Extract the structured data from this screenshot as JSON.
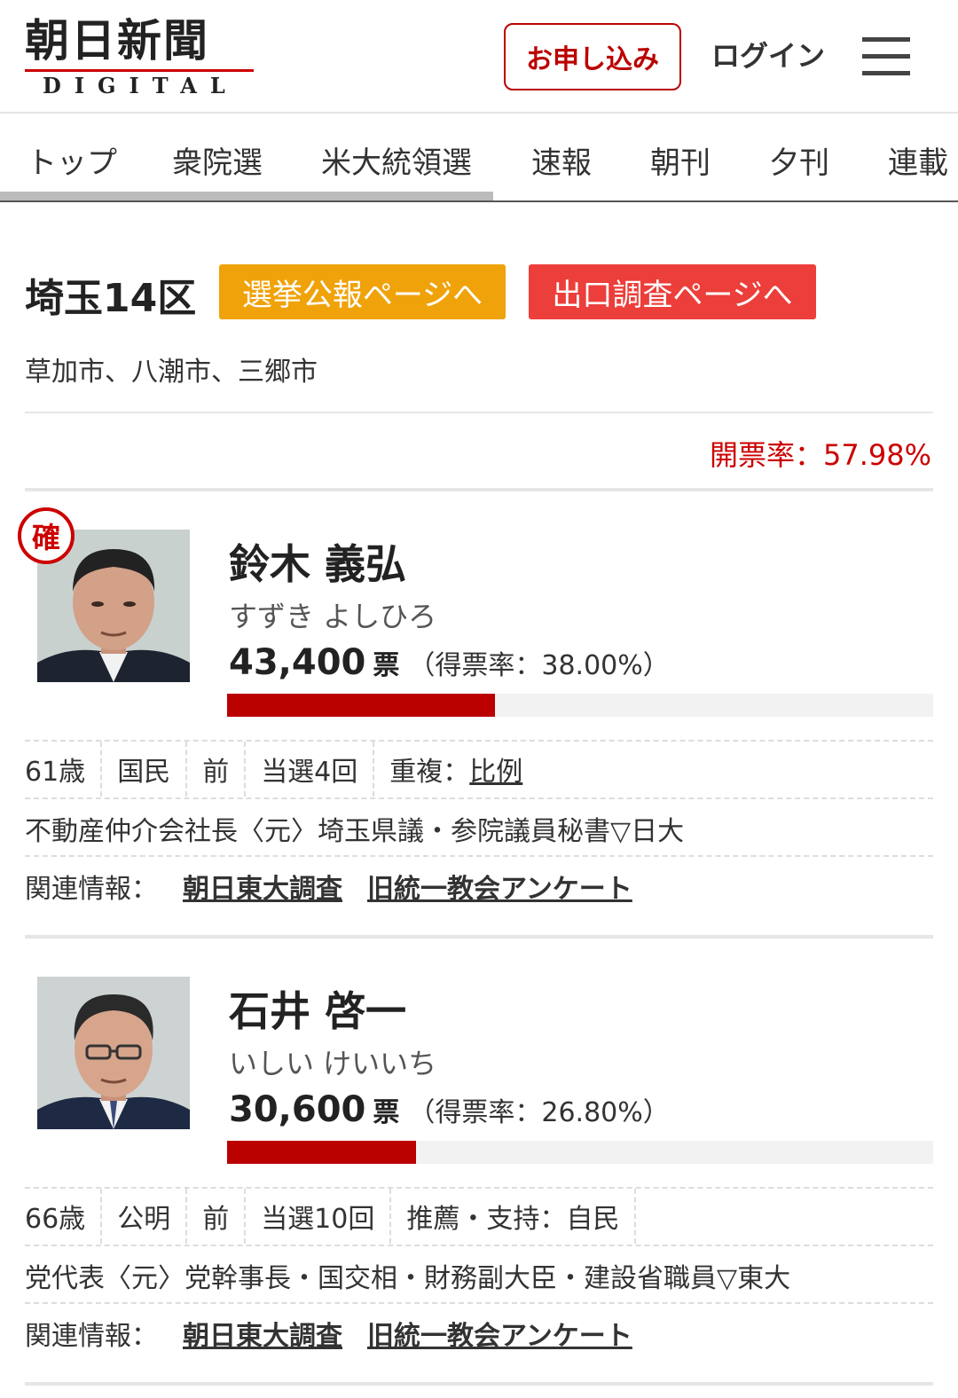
{
  "header": {
    "logo_jp": "朝日新聞",
    "logo_en": "DIGITAL",
    "apply_label": "お申し込み",
    "login_label": "ログイン"
  },
  "nav": {
    "items": [
      "トップ",
      "衆院選",
      "米大統領選",
      "速報",
      "朝刊",
      "夕刊",
      "連載"
    ]
  },
  "district": {
    "title": "埼玉14区",
    "koho_button": "選挙公報ページへ",
    "exit_poll_button": "出口調査ページへ",
    "area": "草加市、八潮市、三郷市",
    "count_rate": "開票率：57.98%"
  },
  "candidates": [
    {
      "elected_badge": "確",
      "name": "鈴木 義弘",
      "kana": "すずき よしひろ",
      "votes": "43,400",
      "votes_unit": "票",
      "vote_rate": "（得票率：38.00%）",
      "bar_share": 0.38,
      "age": "61歳",
      "party": "国民",
      "status": "前",
      "elected_count": "当選4回",
      "extra_label": "重複：",
      "extra_link": "比例",
      "career": "不動産仲介会社長〈元〉埼玉県議・参院議員秘書▽日大",
      "related_label": "関連情報：",
      "related_links": [
        "朝日東大調査",
        "旧統一教会アンケート"
      ]
    },
    {
      "elected_badge": "",
      "name": "石井 啓一",
      "kana": "いしい けいいち",
      "votes": "30,600",
      "votes_unit": "票",
      "vote_rate": "（得票率：26.80%）",
      "bar_share": 0.268,
      "age": "66歳",
      "party": "公明",
      "status": "前",
      "elected_count": "当選10回",
      "extra_label": "推薦・支持：自民",
      "extra_link": "",
      "career": "党代表〈元〉党幹事長・国交相・財務副大臣・建設省職員▽東大",
      "related_label": "関連情報：",
      "related_links": [
        "朝日東大調査",
        "旧統一教会アンケート"
      ]
    }
  ],
  "colors": {
    "accent_red": "#bb0000",
    "koho_orange": "#f0a20a",
    "exit_red": "#ec3e3a"
  }
}
